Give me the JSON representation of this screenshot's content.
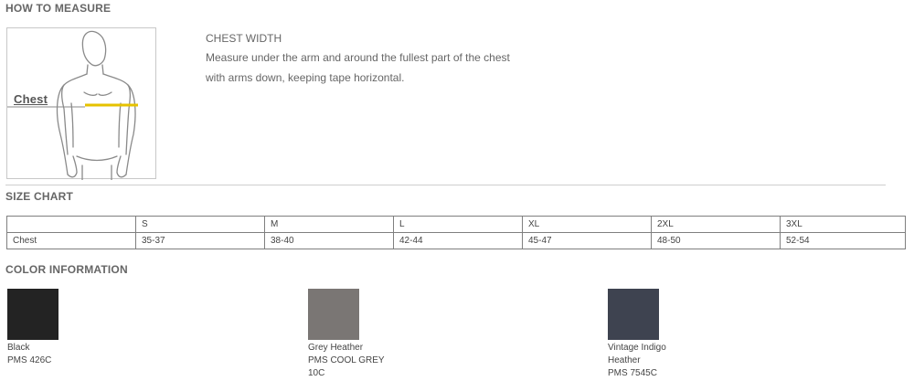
{
  "sections": {
    "how_to_measure": "HOW TO MEASURE",
    "size_chart": "SIZE CHART",
    "color_information": "COLOR INFORMATION"
  },
  "measure": {
    "figure_label": "Chest",
    "title": "CHEST WIDTH",
    "line1": "Measure under the arm and around the fullest part of the chest",
    "line2": "with arms down, keeping tape horizontal."
  },
  "size_chart": {
    "header": [
      "",
      "S",
      "M",
      "L",
      "XL",
      "2XL",
      "3XL"
    ],
    "rows": [
      [
        "Chest",
        "35-37",
        "38-40",
        "42-44",
        "45-47",
        "48-50",
        "52-54"
      ]
    ]
  },
  "colors": [
    {
      "name": "Black",
      "pms": [
        "PMS 426C"
      ],
      "hex": "#232323"
    },
    {
      "name": "Grey Heather",
      "pms": [
        "PMS COOL GREY",
        "10C"
      ],
      "hex": "#7a7674"
    },
    {
      "name": "Vintage Indigo",
      "pms": [
        "Heather",
        "PMS 7545C"
      ],
      "hex": "#3e4350"
    }
  ],
  "accent": {
    "tape": "#e6c200"
  }
}
